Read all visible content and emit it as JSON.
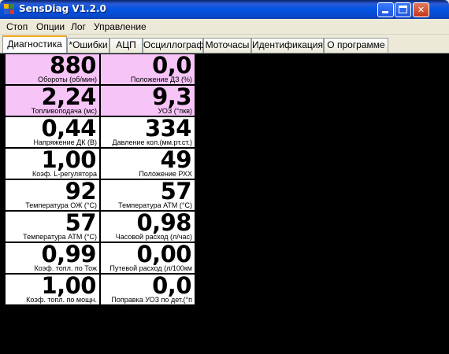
{
  "window": {
    "title": "SensDiag V1.2.0"
  },
  "menu": [
    "Стоп",
    "Опции",
    "Лог",
    "Управление"
  ],
  "tabs": [
    "Диагностика",
    "*Ошибки",
    "АЦП",
    "Осциллограф",
    "Моточасы",
    "Идентификация",
    "О программе"
  ],
  "active_tab": "Диагностика",
  "colors": {
    "highlight_cell": "#f6c4f6",
    "panel_bg": "#000000"
  },
  "gauges": [
    {
      "value": "880",
      "label": "Обороты (об/мин)",
      "highlight": true
    },
    {
      "value": "0,0",
      "label": "Положение ДЗ (%)",
      "highlight": true
    },
    {
      "value": "2,24",
      "label": "Топливоподача (мс)",
      "highlight": true
    },
    {
      "value": "9,3",
      "label": "УОЗ (°пкв)",
      "highlight": true
    },
    {
      "value": "0,44",
      "label": "Напряжение ДК (В)",
      "highlight": false
    },
    {
      "value": "334",
      "label": "Давление кол.(мм.рт.ст.)",
      "highlight": false
    },
    {
      "value": "1,00",
      "label": "Коэф. L-регулятора",
      "highlight": false
    },
    {
      "value": "49",
      "label": "Положение РХХ",
      "highlight": false
    },
    {
      "value": "92",
      "label": "Температура ОЖ (°С)",
      "highlight": false
    },
    {
      "value": "57",
      "label": "Температура АТМ (°С)",
      "highlight": false
    },
    {
      "value": "57",
      "label": "Температура АТМ (°С)",
      "highlight": false
    },
    {
      "value": "0,98",
      "label": "Часовой расход (л/час)",
      "highlight": false
    },
    {
      "value": "0,99",
      "label": "Коэф. топл. по Тож",
      "highlight": false
    },
    {
      "value": "0,00",
      "label": "Путевой расход (л/100км",
      "highlight": false
    },
    {
      "value": "1,00",
      "label": "Коэф. топл. по мощн.",
      "highlight": false
    },
    {
      "value": "0,0",
      "label": "Поправка УОЗ по дет.(°п",
      "highlight": false
    }
  ]
}
